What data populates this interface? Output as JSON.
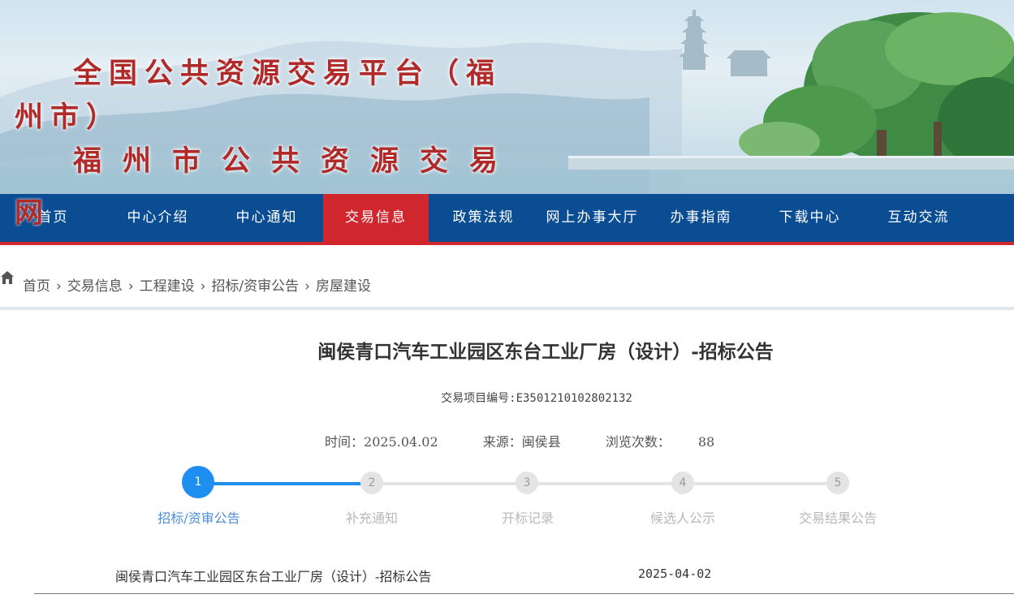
{
  "banner": {
    "title": "全国公共资源交易平台（福州市）",
    "subtitle": "福州市公共资源交易",
    "subtitle_overflow": "网"
  },
  "nav": {
    "items": [
      {
        "label": "首页",
        "active": false
      },
      {
        "label": "中心介绍",
        "active": false
      },
      {
        "label": "中心通知",
        "active": false
      },
      {
        "label": "交易信息",
        "active": true
      },
      {
        "label": "政策法规",
        "active": false
      },
      {
        "label": "网上办事大厅",
        "active": false
      },
      {
        "label": "办事指南",
        "active": false
      },
      {
        "label": "下载中心",
        "active": false
      },
      {
        "label": "互动交流",
        "active": false
      }
    ]
  },
  "breadcrumb": {
    "icon": "home-icon",
    "items": [
      "首页",
      "交易信息",
      "工程建设",
      "招标/资审公告",
      "房屋建设"
    ],
    "separator": "›"
  },
  "article": {
    "title": "闽侯青口汽车工业园区东台工业厂房（设计）-招标公告",
    "code": "交易项目编号:E3501210102802132",
    "time_label": "时间：",
    "time_value": "2025.04.02",
    "source_label": "来源：",
    "source_value": "闽侯县",
    "views_label": "浏览次数：",
    "views_value": "88"
  },
  "steps": {
    "current_index": 0,
    "items": [
      {
        "number": "1",
        "label": "招标/资审公告"
      },
      {
        "number": "2",
        "label": "补充通知"
      },
      {
        "number": "3",
        "label": "开标记录"
      },
      {
        "number": "4",
        "label": "候选人公示"
      },
      {
        "number": "5",
        "label": "交易结果公告"
      }
    ]
  },
  "list": {
    "rows": [
      {
        "title": "闽侯青口汽车工业园区东台工业厂房（设计）-招标公告",
        "date": "2025-04-02"
      }
    ]
  },
  "colors": {
    "nav_bg": "#0b4d93",
    "nav_active": "#d0272f",
    "step_active": "#1f8ef1",
    "banner_text": "#b02a2a"
  }
}
